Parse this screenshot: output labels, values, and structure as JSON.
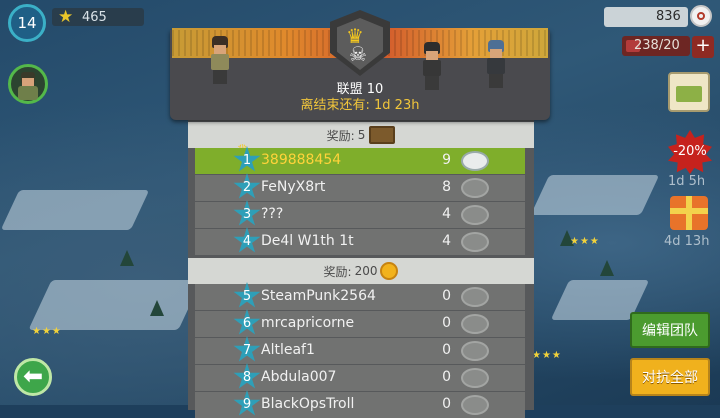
{
  "hud": {
    "level": "14",
    "xp": "465",
    "coins": "836",
    "troops": "238/20"
  },
  "side": {
    "sale_label": "-20%",
    "sale_timer": "1d 5h",
    "gift_timer": "4d 13h"
  },
  "buttons": {
    "edit_team": "编辑团队",
    "attack_all": "对抗全部"
  },
  "league": {
    "title": "联盟 10",
    "timer": "离结束还有: 1d 23h"
  },
  "reward_tiers": [
    {
      "label": "奖励:",
      "value": "5"
    },
    {
      "label": "奖励:",
      "value": "200"
    }
  ],
  "leaderboard": [
    {
      "rank": "1",
      "name": "389888454",
      "score": "9"
    },
    {
      "rank": "2",
      "name": "FeNyX8rt",
      "score": "8"
    },
    {
      "rank": "3",
      "name": "???",
      "score": "4"
    },
    {
      "rank": "4",
      "name": "De4l W1th 1t",
      "score": "4"
    },
    {
      "rank": "5",
      "name": "SteamPunk2564",
      "score": "0"
    },
    {
      "rank": "6",
      "name": "mrcapricorne",
      "score": "0"
    },
    {
      "rank": "7",
      "name": "Altleaf1",
      "score": "0"
    },
    {
      "rank": "8",
      "name": "Abdula007",
      "score": "0"
    },
    {
      "rank": "9",
      "name": "BlackOpsTroll",
      "score": "0"
    }
  ],
  "colors": {
    "highlight_row": "#7fae2b",
    "rank_star": "#2e9fb8",
    "attack_button": "#f0b11d",
    "edit_button": "#4b9b2f"
  }
}
